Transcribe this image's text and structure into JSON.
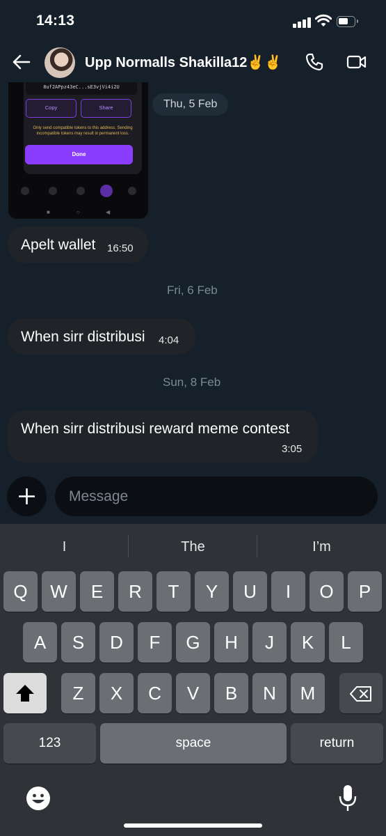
{
  "status_bar": {
    "time": "14:13"
  },
  "header": {
    "contact_name": "Upp Normalls Shakilla12✌️✌️"
  },
  "attachment": {
    "address_text": "8uf2APpz43eC...sE3vjVi4i2U",
    "copy_label": "Copy",
    "share_label": "Share",
    "warning_text": "Only send compatible tokens to this address. Sending incompatible tokens may result in permanent loss.",
    "done_label": "Done"
  },
  "messages": [
    {
      "date": "Thu, 5 Feb"
    },
    {
      "text": "Apelt wallet",
      "time": "16:50"
    },
    {
      "date": "Fri, 6 Feb"
    },
    {
      "text": "When sirr distribusi",
      "time": "4:04"
    },
    {
      "date": "Sun, 8 Feb"
    },
    {
      "text": "When sirr distribusi reward meme contest",
      "time": "3:05"
    }
  ],
  "composer": {
    "placeholder": "Message"
  },
  "keyboard": {
    "suggestions": [
      "I",
      "The",
      "I’m"
    ],
    "row1": [
      "Q",
      "W",
      "E",
      "R",
      "T",
      "Y",
      "U",
      "I",
      "O",
      "P"
    ],
    "row2": [
      "A",
      "S",
      "D",
      "F",
      "G",
      "H",
      "J",
      "K",
      "L"
    ],
    "row3": [
      "Z",
      "X",
      "C",
      "V",
      "B",
      "N",
      "M"
    ],
    "numbers_label": "123",
    "space_label": "space",
    "return_label": "return"
  }
}
